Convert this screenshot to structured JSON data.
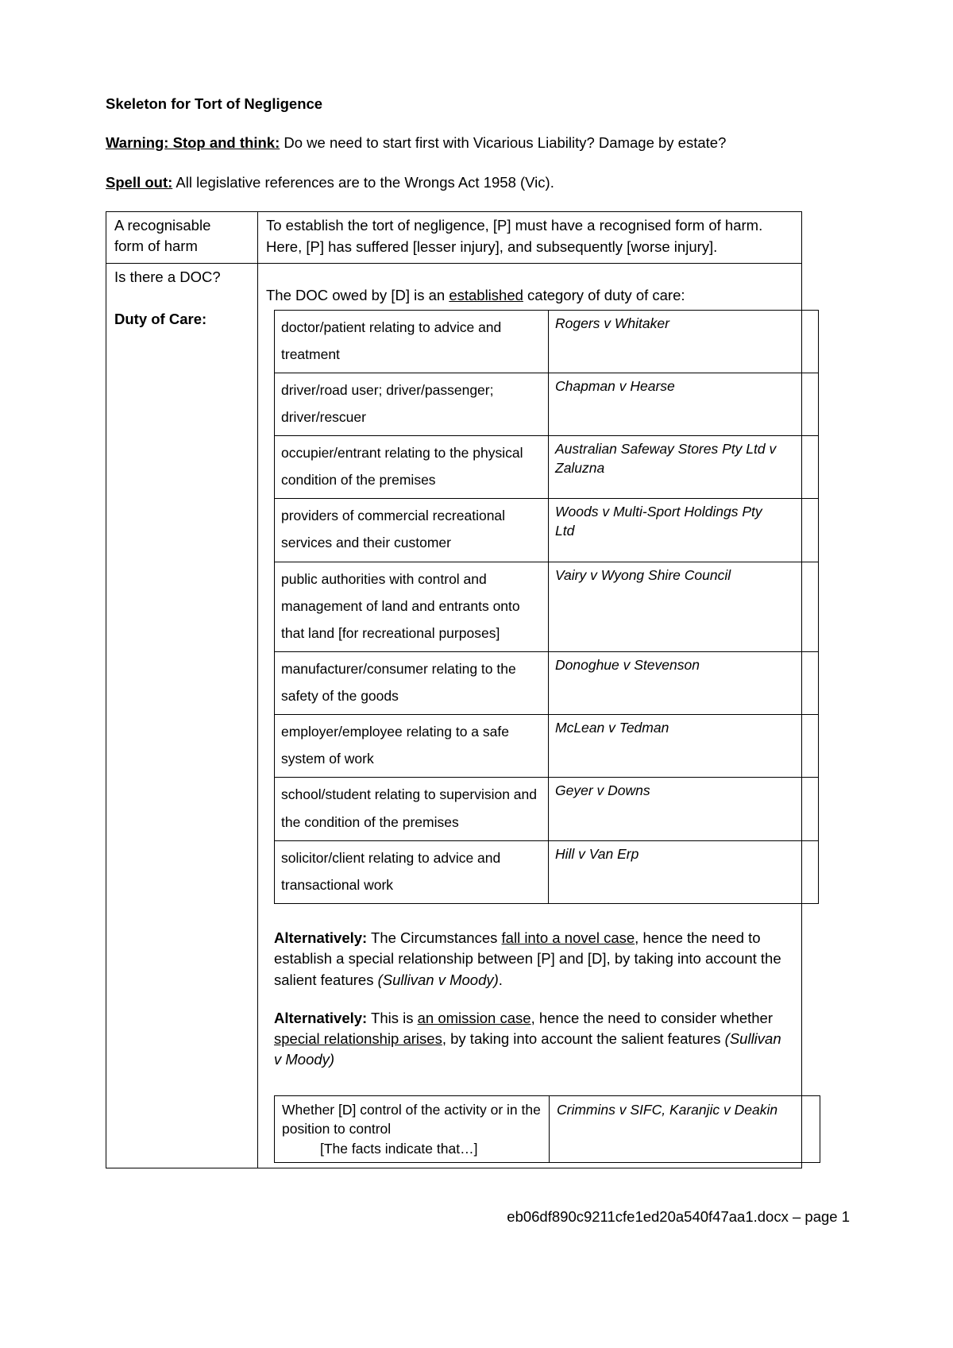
{
  "document": {
    "title": "Skeleton for Tort of Negligence",
    "warning_label": "Warning: Stop and think:",
    "warning_text": " Do we need to start first with Vicarious Liability? Damage by estate?",
    "spellout_label": "Spell out:",
    "spellout_text": " All legislative references are to the Wrongs Act 1958 (Vic)."
  },
  "rows": {
    "harm": {
      "label": "A recognisable form of harm",
      "label_line1": "A recognisable",
      "label_line2": "form of harm",
      "content_line1": "To establish the tort of negligence, [P] must have a recognised form of harm.",
      "content_line2": "Here, [P] has suffered [lesser injury], and subsequently [worse injury]."
    },
    "doc": {
      "label_line1": "Is there a DOC?",
      "label_line2": "Duty of Care:",
      "lead_pre": "The DOC owed by [D] is an ",
      "lead_underlined": "established",
      "lead_post": " category of duty of care:"
    }
  },
  "established_categories": {
    "rows": [
      {
        "category": "doctor/patient relating to advice and treatment",
        "case_lines": [
          "Rogers v Whitaker"
        ]
      },
      {
        "category": "driver/road user; driver/passenger; driver/rescuer",
        "case_lines": [
          "Chapman v Hearse"
        ]
      },
      {
        "category": "occupier/entrant relating to the physical condition of the premises",
        "case_lines": [
          "Australian Safeway Stores Pty Ltd v",
          "Zaluzna"
        ]
      },
      {
        "category": "providers of commercial recreational services and their customer",
        "case_lines": [
          "Woods v Multi-Sport Holdings Pty",
          "Ltd"
        ]
      },
      {
        "category": "public authorities with control and management of land and entrants onto that land [for recreational purposes]",
        "case_lines": [
          "Vairy v Wyong Shire Council"
        ]
      },
      {
        "category": "manufacturer/consumer relating to the safety of the goods",
        "case_lines": [
          "Donoghue v Stevenson"
        ]
      },
      {
        "category": "employer/employee relating to a safe system of work",
        "case_lines": [
          "McLean v Tedman"
        ]
      },
      {
        "category": "school/student relating to supervision and the condition of the premises",
        "case_lines": [
          "Geyer v Downs"
        ]
      },
      {
        "category": "solicitor/client relating to advice and transactional work",
        "case_lines": [
          "Hill v Van Erp"
        ]
      }
    ]
  },
  "alternatives": {
    "novel": {
      "label": "Alternatively:",
      "pre": " The Circumstances ",
      "underlined": "fall into a novel case",
      "post": ", hence the need to establish a special relationship between [P] and [D], by taking into account the salient features ",
      "citation": "(Sullivan v Moody)",
      "tail": "."
    },
    "omission": {
      "label": "Alternatively:",
      "pre": " This is ",
      "underlined1": "an omission case",
      "mid": ", hence the need to consider whether ",
      "underlined2": "special relationship arises",
      "post": ", by taking into account the salient features ",
      "citation": "(Sullivan v Moody)"
    }
  },
  "control_row": {
    "line1": "Whether [D] control of the activity",
    "line2": "or in the position to control",
    "line3": "[The facts indicate that…]",
    "case": "Crimmins v SIFC, Karanjic v Deakin"
  },
  "footer": {
    "text": "eb06df890c9211cfe1ed20a540f47aa1.docx – page 1"
  }
}
